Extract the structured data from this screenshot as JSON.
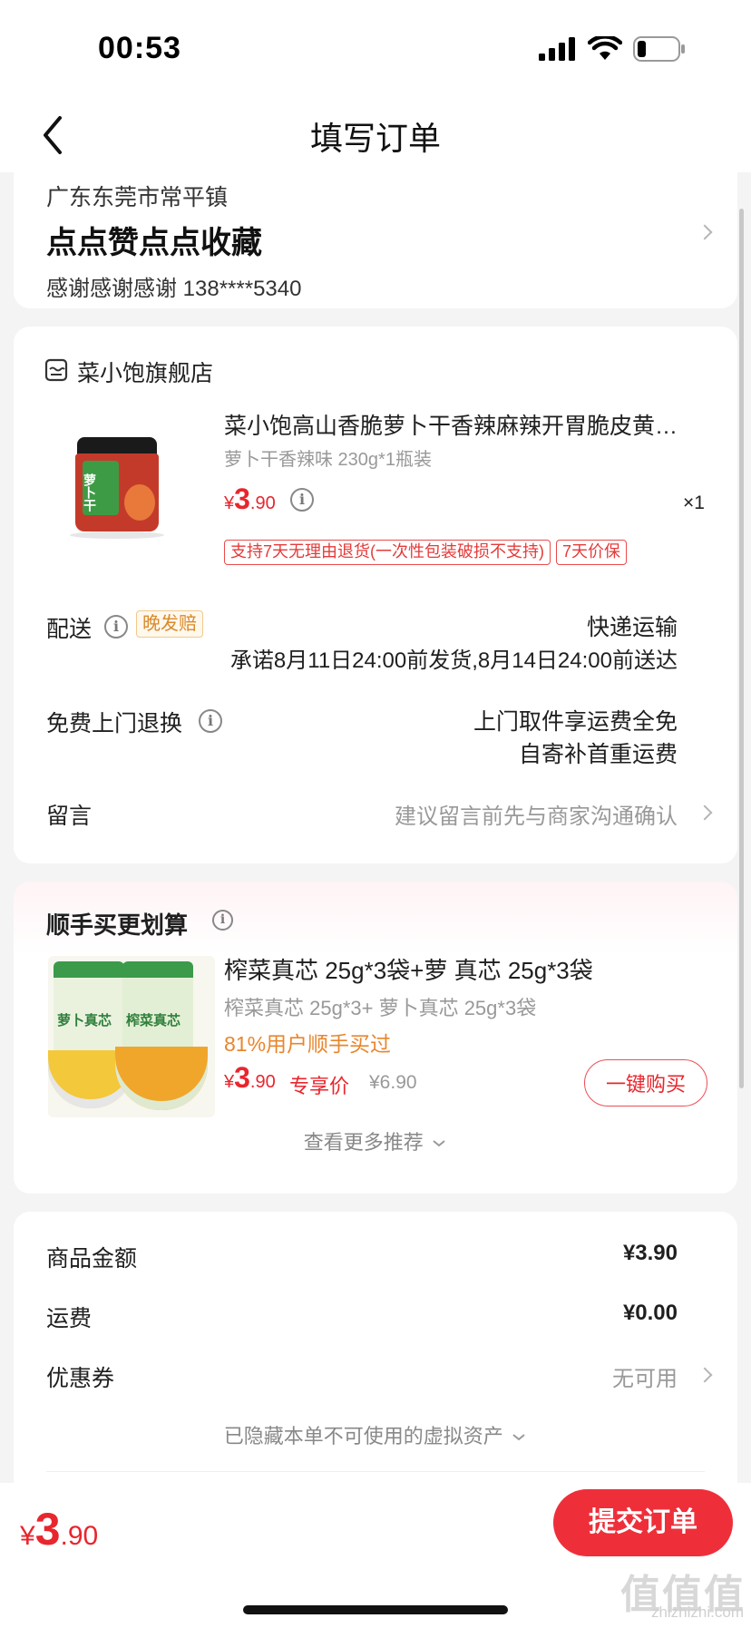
{
  "status_bar": {
    "time": "00:53"
  },
  "nav": {
    "title": "填写订单"
  },
  "address": {
    "region": "广东东莞市常平镇",
    "detail": "点点赞点点收藏",
    "contact": "感谢感谢感谢  138****5340"
  },
  "store": {
    "name": "菜小饱旗舰店",
    "product": {
      "title": "菜小饱高山香脆萝卜干香辣麻辣开胃脆皮黄…",
      "spec": "萝卜干香辣味 230g*1瓶装",
      "price_symbol": "¥",
      "price_int": "3",
      "price_dec": ".90",
      "quantity": "×1",
      "tags": [
        "支持7天无理由退货(一次性包装破损不支持)",
        "7天价保"
      ],
      "image_text": "萝卜干"
    },
    "shipping": {
      "label": "配送",
      "badge": "晚发赔",
      "method": "快递运输",
      "promise": "承诺8月11日24:00前发货,8月14日24:00前送达"
    },
    "returns": {
      "label": "免费上门退换",
      "line1": "上门取件享运费全免",
      "line2": "自寄补首重运费"
    },
    "message": {
      "label": "留言",
      "placeholder": "建议留言前先与商家沟通确认"
    }
  },
  "bundle": {
    "title": "顺手买更划算",
    "item_title": "榨菜真芯 25g*3袋+萝 真芯 25g*3袋",
    "item_spec": "榨菜真芯 25g*3+ 萝卜真芯 25g*3袋",
    "social_proof": "81%用户顺手买过",
    "price_symbol": "¥",
    "price_int": "3",
    "price_dec": ".90",
    "price_tag": "专享价",
    "original_price": "¥6.90",
    "buy_button": "一键购买",
    "more": "查看更多推荐",
    "image_labels": [
      "萝卜真芯",
      "榨菜真芯"
    ]
  },
  "summary": {
    "rows": [
      {
        "label": "商品金额",
        "value": "¥3.90"
      },
      {
        "label": "运费",
        "value": "¥0.00"
      },
      {
        "label": "优惠券",
        "value": "无可用"
      }
    ],
    "hidden_assets": "已隐藏本单不可使用的虚拟资产"
  },
  "footer": {
    "price_symbol": "¥",
    "price_int": "3",
    "price_dec": ".90",
    "submit": "提交订单"
  },
  "watermark": {
    "main": "值值值",
    "sub": "zhizhizhi.com"
  },
  "colors": {
    "accent": "#ee2f3a",
    "orange": "#e8862d",
    "background": "#f4f4f4"
  }
}
